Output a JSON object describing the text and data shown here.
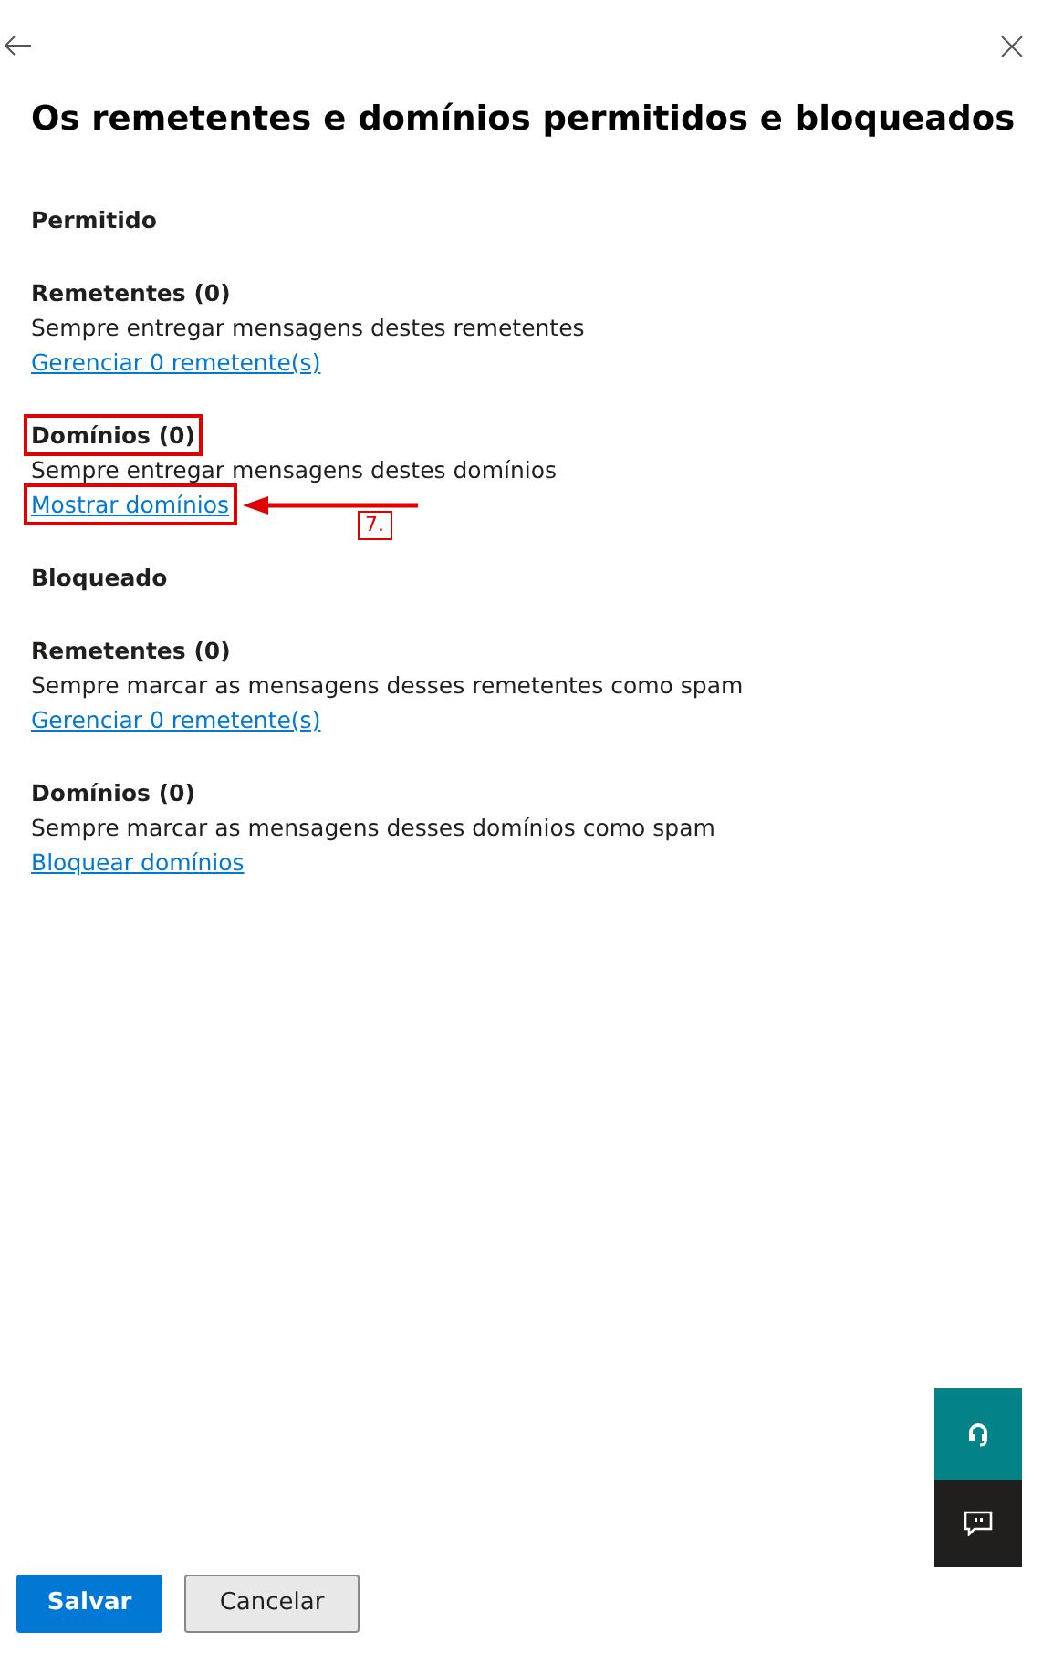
{
  "title": "Os remetentes e domínios permitidos e bloqueados",
  "sections": [
    {
      "heading": "Permitido",
      "groups": [
        {
          "heading": "Remetentes (0)",
          "heading_highlighted": false,
          "description": "Sempre entregar mensagens destes remetentes",
          "link": "Gerenciar 0 remetente(s)",
          "link_highlighted": false
        },
        {
          "heading": "Domínios (0)",
          "heading_highlighted": true,
          "description": "Sempre entregar mensagens destes domínios",
          "link": "Mostrar domínios",
          "link_highlighted": true,
          "callout": "7."
        }
      ]
    },
    {
      "heading": "Bloqueado",
      "groups": [
        {
          "heading": "Remetentes (0)",
          "heading_highlighted": false,
          "description": "Sempre marcar as mensagens desses remetentes como spam",
          "link": "Gerenciar 0 remetente(s)",
          "link_highlighted": false
        },
        {
          "heading": "Domínios (0)",
          "heading_highlighted": false,
          "description": "Sempre marcar as mensagens desses domínios como spam",
          "link": "Bloquear domínios",
          "link_highlighted": false
        }
      ]
    }
  ],
  "buttons": [
    {
      "label": "Salvar",
      "kind": "primary"
    },
    {
      "label": "Cancelar",
      "kind": "secondary"
    }
  ]
}
